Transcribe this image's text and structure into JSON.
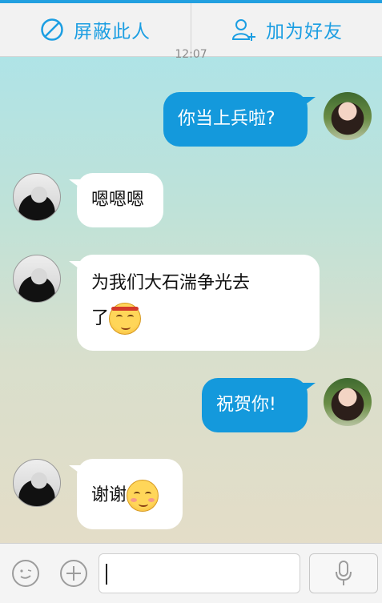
{
  "header": {
    "block_label": "屏蔽此人",
    "add_friend_label": "加为好友",
    "accent_color": "#1b9ee2"
  },
  "timestamp": "12:07",
  "messages": [
    {
      "side": "out",
      "text": "你当上兵啦?"
    },
    {
      "side": "in",
      "text": "嗯嗯嗯"
    },
    {
      "side": "in",
      "text_line1": "为我们大石湍争光去",
      "text_line2": "了",
      "emoji": "headband-emoji"
    },
    {
      "side": "out",
      "text": "祝贺你!"
    },
    {
      "side": "in",
      "text": "谢谢",
      "emoji": "blush-emoji"
    }
  ],
  "composer": {
    "emoji_icon": "smiley-icon",
    "plus_icon": "plus-icon",
    "voice_icon": "microphone-icon",
    "input_value": ""
  }
}
